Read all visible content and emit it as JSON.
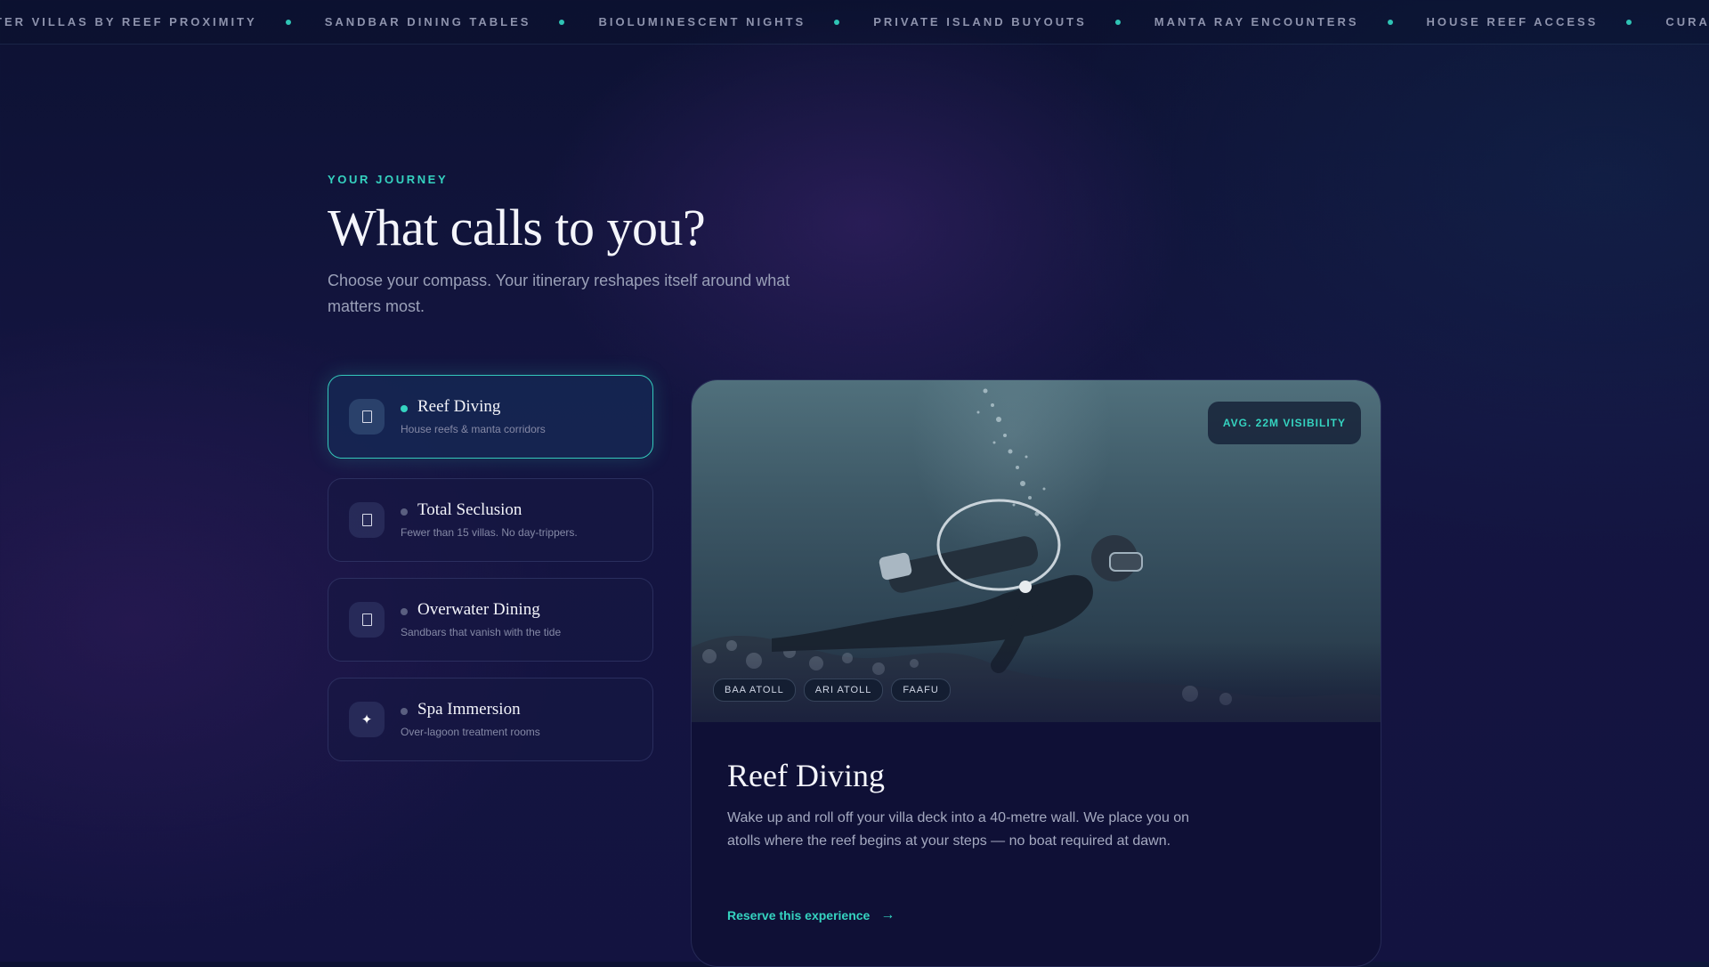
{
  "ticker": {
    "items": [
      "TER VILLAS BY REEF PROXIMITY",
      "SANDBAR DINING TABLES",
      "BIOLUMINESCENT NIGHTS",
      "PRIVATE ISLAND BUYOUTS",
      "MANTA RAY ENCOUNTERS",
      "HOUSE REEF ACCESS",
      "CURATED BY ATOLL"
    ],
    "accent": "#2fc4b5"
  },
  "header": {
    "eyebrow": "YOUR JOURNEY",
    "title": "What calls to you?",
    "intro": "Choose your compass. Your itinerary reshapes itself around what matters most."
  },
  "options": [
    {
      "title": "Reef Diving",
      "subtitle": "House reefs & manta corridors",
      "icon": "doc-icon",
      "active": true
    },
    {
      "title": "Total Seclusion",
      "subtitle": "Fewer than 15 villas. No day-trippers.",
      "icon": "doc-icon",
      "active": false
    },
    {
      "title": "Overwater Dining",
      "subtitle": "Sandbars that vanish with the tide",
      "icon": "doc-icon",
      "active": false
    },
    {
      "title": "Spa Immersion",
      "subtitle": "Over-lagoon treatment rooms",
      "icon": "sparkle-icon",
      "active": false
    }
  ],
  "feature": {
    "badge": "AVG. 22M VISIBILITY",
    "tags": [
      "BAA ATOLL",
      "ARI ATOLL",
      "FAAFU"
    ],
    "title": "Reef Diving",
    "body": "Wake up and roll off your villa deck into a 40-metre wall. We place you on atolls where the reef begins at your steps — no boat required at dawn.",
    "cta": "Reserve this experience",
    "cta_icon": "arrow-right-icon"
  },
  "colors": {
    "accent": "#35d3c0",
    "background": "#131340",
    "card": "#0f1036"
  }
}
